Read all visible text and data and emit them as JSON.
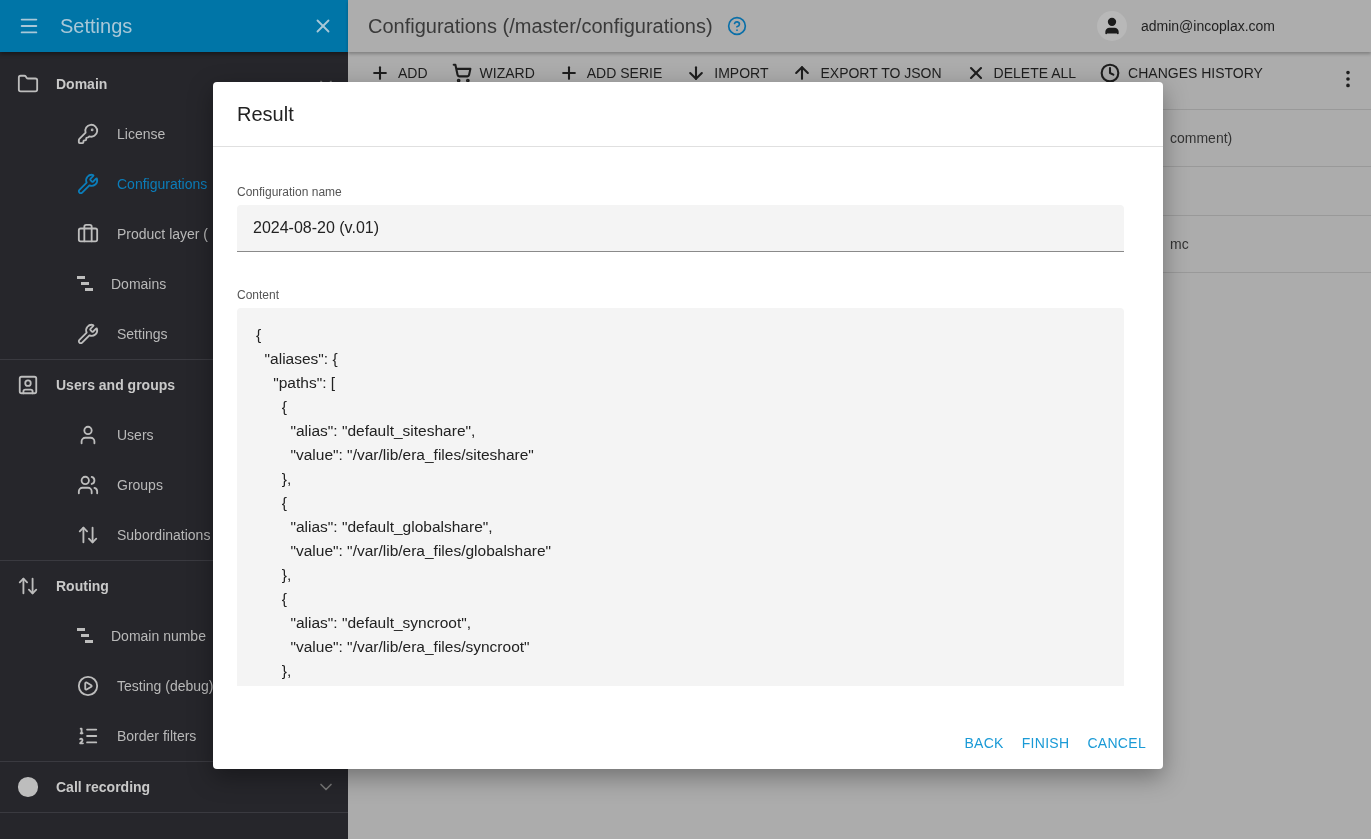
{
  "sidebar": {
    "title": "Settings",
    "groups": [
      {
        "label": "Domain",
        "items": [
          {
            "label": "License",
            "selected": false
          },
          {
            "label": "Configurations",
            "selected": true
          },
          {
            "label": "Product layer (",
            "selected": false
          },
          {
            "label": "Domains",
            "selected": false
          },
          {
            "label": "Settings",
            "selected": false
          }
        ]
      },
      {
        "label": "Users and groups",
        "items": [
          {
            "label": "Users",
            "selected": false
          },
          {
            "label": "Groups",
            "selected": false
          },
          {
            "label": "Subordinations",
            "selected": false
          }
        ]
      },
      {
        "label": "Routing",
        "items": [
          {
            "label": "Domain numbe",
            "selected": false
          },
          {
            "label": "Testing (debug)",
            "selected": false
          },
          {
            "label": "Border filters",
            "selected": false
          }
        ]
      },
      {
        "label": "Call recording"
      }
    ]
  },
  "header": {
    "title": "Configurations (/master/configurations)",
    "user": "admin@incoplax.com"
  },
  "toolbar": [
    "ADD",
    "WIZARD",
    "ADD SERIE",
    "IMPORT",
    "EXPORT TO JSON",
    "DELETE ALL",
    "CHANGES HISTORY"
  ],
  "table": {
    "rows": [
      {
        "text": "comment)"
      },
      {},
      {
        "text": "mc"
      }
    ]
  },
  "dialog": {
    "title": "Result",
    "name_label": "Configuration name",
    "name_value": "2024-08-20 (v.01)",
    "content_label": "Content",
    "content": [
      "{",
      "  \"aliases\": {",
      "    \"paths\": [",
      "      {",
      "        \"alias\": \"default_siteshare\",",
      "        \"value\": \"/var/lib/era_files/siteshare\"",
      "      },",
      "      {",
      "        \"alias\": \"default_globalshare\",",
      "        \"value\": \"/var/lib/era_files/globalshare\"",
      "      },",
      "      {",
      "        \"alias\": \"default_syncroot\",",
      "        \"value\": \"/var/lib/era_files/syncroot\"",
      "      },"
    ],
    "buttons": [
      "BACK",
      "FINISH",
      "CANCEL"
    ]
  }
}
